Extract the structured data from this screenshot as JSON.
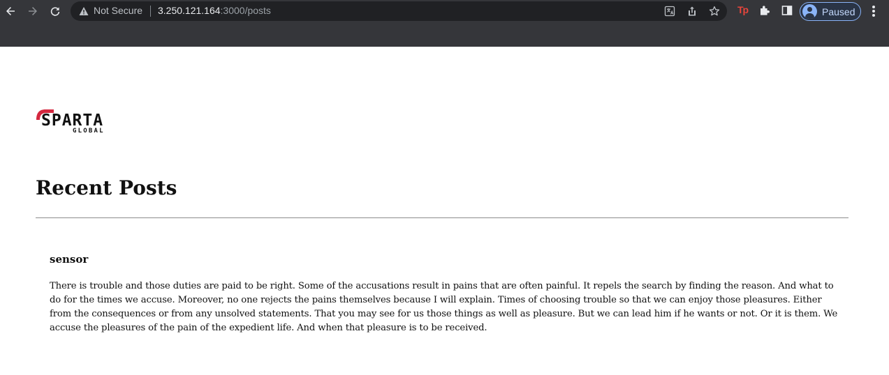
{
  "browser": {
    "security_label": "Not Secure",
    "url_host": "3.250.121.164",
    "url_rest": ":3000/posts",
    "profile_label": "Paused",
    "extension_label": "Tp"
  },
  "brand": {
    "name": "SPARTA",
    "tagline": "GLOBAL",
    "accent_color": "#d4283f"
  },
  "page": {
    "title": "Recent Posts"
  },
  "posts": [
    {
      "title": "sensor",
      "body": "There is trouble and those duties are paid to be right. Some of the accusations result in pains that are often painful. It repels the search by finding the reason. And what to do for the times we accuse. Moreover, no one rejects the pains themselves because I will explain. Times of choosing trouble so that we can enjoy those pleasures. Either from the consequences or from any unsolved statements. That you may see for us those things as well as pleasure. But we can lead him if he wants or not. Or it is them. We accuse the pleasures of the pain of the expedient life. And when that pleasure is to be received."
    }
  ],
  "icons": [
    "back-icon",
    "forward-icon",
    "reload-icon",
    "warning-icon",
    "translate-icon",
    "share-icon",
    "star-icon",
    "extensions-icon",
    "side-panel-icon",
    "avatar-icon",
    "menu-icon"
  ]
}
